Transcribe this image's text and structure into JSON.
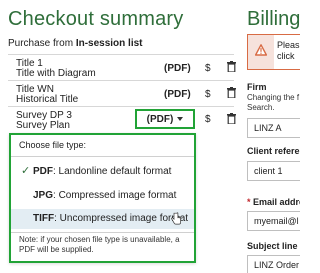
{
  "checkout": {
    "title": "Checkout summary",
    "purchase_prefix": "Purchase from ",
    "purchase_list": "In-session list",
    "items": [
      {
        "title": "Title 1",
        "subtitle": "Title with Diagram",
        "format": "(PDF)",
        "price": "$"
      },
      {
        "title": "Title WN",
        "subtitle": "Historical Title",
        "format": "(PDF)",
        "price": "$"
      },
      {
        "title": "Survey DP 3",
        "subtitle": "Survey Plan",
        "format": "(PDF)",
        "price": "$"
      }
    ]
  },
  "file_type_menu": {
    "heading": "Choose file type:",
    "options": [
      {
        "type": "PDF",
        "desc": ": Landonline default format",
        "selected": true
      },
      {
        "type": "JPG",
        "desc": ": Compressed image format",
        "selected": false
      },
      {
        "type": "TIFF",
        "desc": ": Uncompressed image format",
        "selected": false
      }
    ],
    "note": "Note: if your chosen file type is unavailable, a PDF will be supplied."
  },
  "billing": {
    "title": "Billing d",
    "alert_line1": "Pleas",
    "alert_line2": "click",
    "firm_label": "Firm",
    "firm_help_1": "Changing the f",
    "firm_help_2": "Search.",
    "firm_value": "LINZ A",
    "client_ref_label": "Client referen",
    "client_ref_value": "client 1",
    "email_required_mark": "*",
    "email_label": " Email address",
    "email_value": "myemail@l",
    "subject_label": "Subject line",
    "subject_value": "LINZ Order"
  },
  "colors": {
    "accent": "#2f6e3a",
    "focus": "#21a336",
    "alert_border": "#d86b44",
    "hover": "#e3edf3"
  }
}
